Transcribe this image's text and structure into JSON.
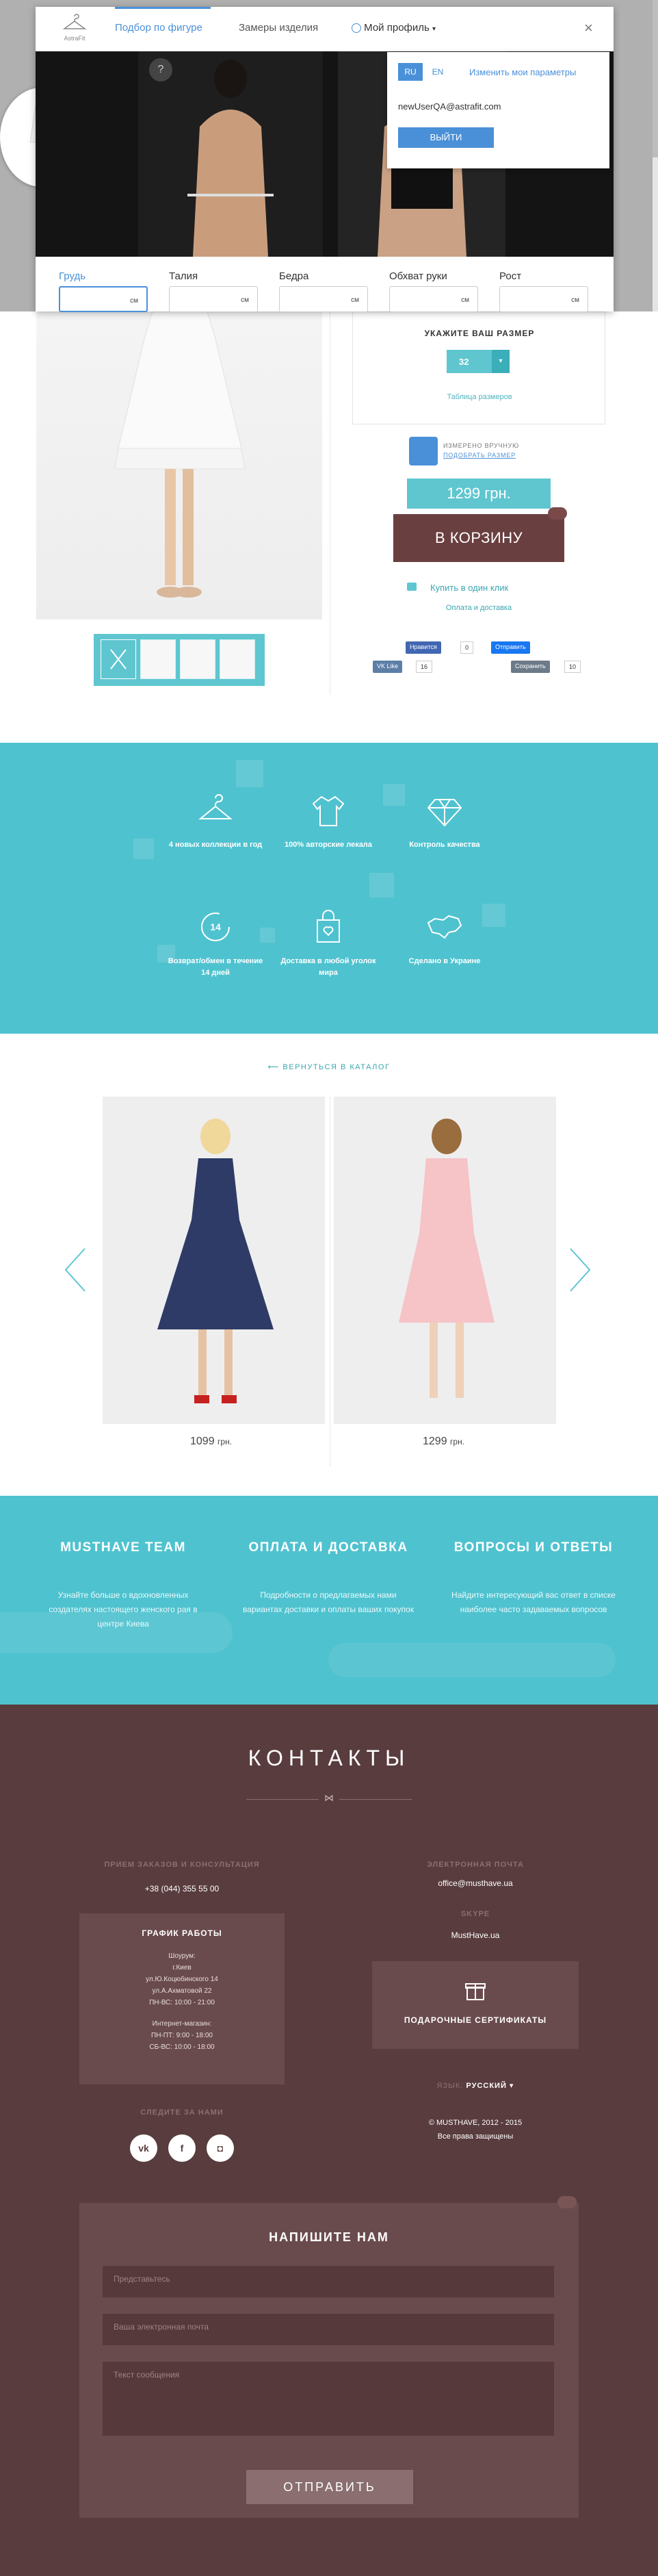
{
  "modal": {
    "logo_text": "AstraFit",
    "tabs": [
      "Подбор по фигуре",
      "Замеры изделия"
    ],
    "profile_label": "Мой профиль",
    "close_icon": "close-icon",
    "help_icon": "?",
    "measurements": [
      {
        "label": "Грудь",
        "unit": "см"
      },
      {
        "label": "Талия",
        "unit": "см"
      },
      {
        "label": "Бедра",
        "unit": "см"
      },
      {
        "label": "Обхват руки",
        "unit": "см"
      },
      {
        "label": "Рост",
        "unit": "см"
      }
    ],
    "profile_popup": {
      "lang_ru": "RU",
      "lang_en": "EN",
      "change_params": "Изменить мои параметры",
      "email": "newUserQA@astrafit.com",
      "logout": "ВЫЙТИ"
    }
  },
  "size": {
    "heading": "УКАЖИТЕ ВАШ РАЗМЕР",
    "value": "32",
    "table_link": "Таблица размеров",
    "measured_line1": "ИЗМЕРЕНО ВРУЧНУЮ",
    "measured_line2": "ПОДОБРАТЬ РАЗМЕР"
  },
  "buy": {
    "price": "1299 грн.",
    "cart": "В КОРЗИНУ",
    "one_click": "Купить в один клик",
    "delivery": "Оплата и доставка"
  },
  "social_share": {
    "fb_like": "Нравится",
    "fb_count": "0",
    "fb_send": "Отправить",
    "vk_like": "Like",
    "vk_count": "16",
    "save": "Сохранить",
    "save_count": "10"
  },
  "features": [
    {
      "icon": "hanger-icon",
      "text": "4 новых коллекции в год"
    },
    {
      "icon": "shirt-icon",
      "text": "100% авторские лекала"
    },
    {
      "icon": "diamond-icon",
      "text": "Контроль качества"
    },
    {
      "icon": "return-14-icon",
      "text": "Возврат/обмен в течение 14 дней"
    },
    {
      "icon": "bag-icon",
      "text": "Доставка в любой уголок мира"
    },
    {
      "icon": "ukraine-map-icon",
      "text": "Сделано в Украине"
    }
  ],
  "related": {
    "back_link": "ВЕРНУТЬСЯ В КАТАЛОГ",
    "items": [
      {
        "price": "1099",
        "currency": "грн."
      },
      {
        "price": "1299",
        "currency": "грн."
      }
    ]
  },
  "info": [
    {
      "title": "MUSTHAVE TEAM",
      "text": "Узнайте больше о вдохновленных создателях настоящего женского рая в центре Киева"
    },
    {
      "title": "ОПЛАТА И ДОСТАВКА",
      "text": "Подробности о предлагаемых нами вариантах доставки и оплаты ваших покупок"
    },
    {
      "title": "ВОПРОСЫ И ОТВЕТЫ",
      "text": "Найдите интересующий вас ответ в списке наиболее часто задаваемых вопросов"
    }
  ],
  "contacts": {
    "title": "КОНТАКТЫ",
    "orders_label": "ПРИЕМ ЗАКАЗОВ И КОНСУЛЬТАЦИЯ",
    "phone": "+38 (044) 355 55 00",
    "email_label": "ЭЛЕКТРОННАЯ ПОЧТА",
    "email": "office@musthave.ua",
    "skype_label": "SKYPE",
    "skype": "MustHave.ua",
    "hours_title": "ГРАФИК РАБОТЫ",
    "showroom": [
      "Шоурум:",
      "г.Киев",
      "ул.Ю.Коцюбинского 14",
      "ул.А.Ахматовой 22",
      "ПН-ВС: 10:00 - 21:00"
    ],
    "shop": [
      "Интернет-магазин:",
      "ПН-ПТ: 9:00 - 18:00",
      "СБ-ВС: 10:00 - 18:00"
    ],
    "gift": "ПОДАРОЧНЫЕ СЕРТИФИКАТЫ",
    "lang_label": "ЯЗЫК:",
    "lang_value": "РУССКИЙ",
    "follow": "СЛЕДИТЕ ЗА НАМИ",
    "copyright1": "© MUSTHAVE, 2012 - 2015",
    "copyright2": "Все права защищены"
  },
  "form": {
    "title": "НАПИШИТЕ НАМ",
    "name": "Представьтесь",
    "email": "Ваша электронная почта",
    "message": "Текст сообщения",
    "send": "ОТПРАВИТЬ"
  }
}
